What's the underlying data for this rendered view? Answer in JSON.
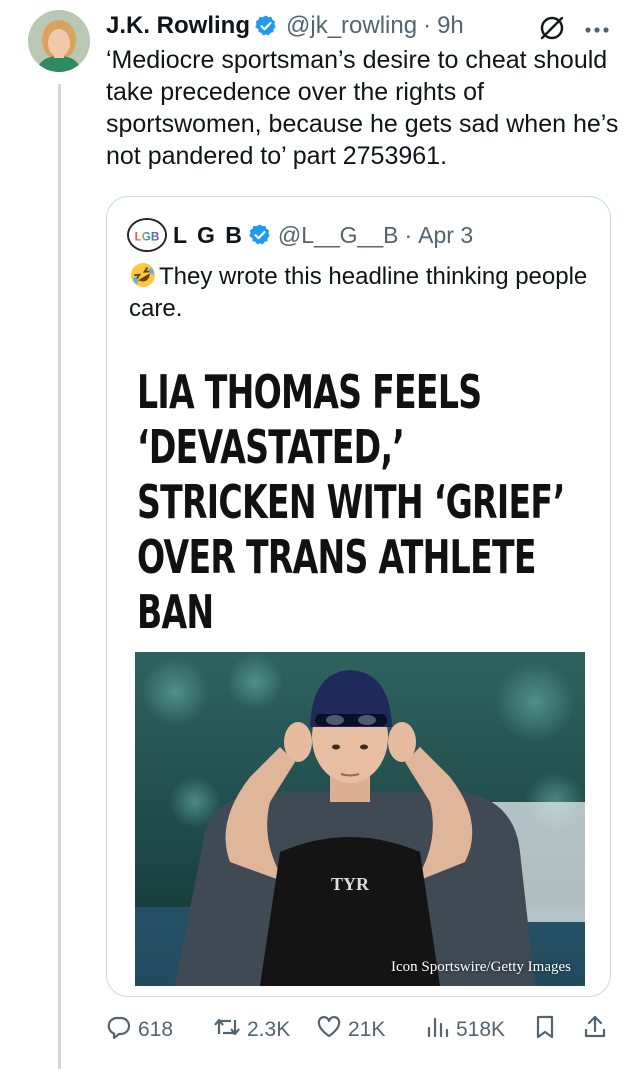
{
  "author": {
    "display_name": "J.K. Rowling",
    "handle": "@jk_rowling",
    "separator": "·",
    "time": "9h",
    "verified_color": "#1d9bf0"
  },
  "tweet": {
    "text": "‘Mediocre sportsman’s desire to cheat should take precedence over the rights of sportswomen, because he gets sad when he’s not pandered to’ part 2753961."
  },
  "quote": {
    "avatar_label": "LGB",
    "display_name": "L G B",
    "handle": "@L__G__B",
    "separator": "·",
    "time": "Apr 3",
    "emoji": "rolling-on-floor-laughing",
    "text": "They wrote this headline thinking people care.",
    "headline_lines": [
      "LIA THOMAS FEELS",
      "‘DEVASTATED,’",
      "STRICKEN WITH ‘GRIEF’",
      "OVER TRANS ATHLETE",
      "BAN"
    ],
    "photo_caption": "Icon Sportswire/Getty Images",
    "photo_cap_brand": "TYR"
  },
  "actions": {
    "replies": "618",
    "reposts": "2.3K",
    "likes": "21K",
    "views": "518K"
  },
  "icons": [
    "grok-icon",
    "more-icon",
    "verified-icon",
    "reply-icon",
    "retweet-icon",
    "like-icon",
    "views-icon",
    "bookmark-icon",
    "share-icon"
  ]
}
